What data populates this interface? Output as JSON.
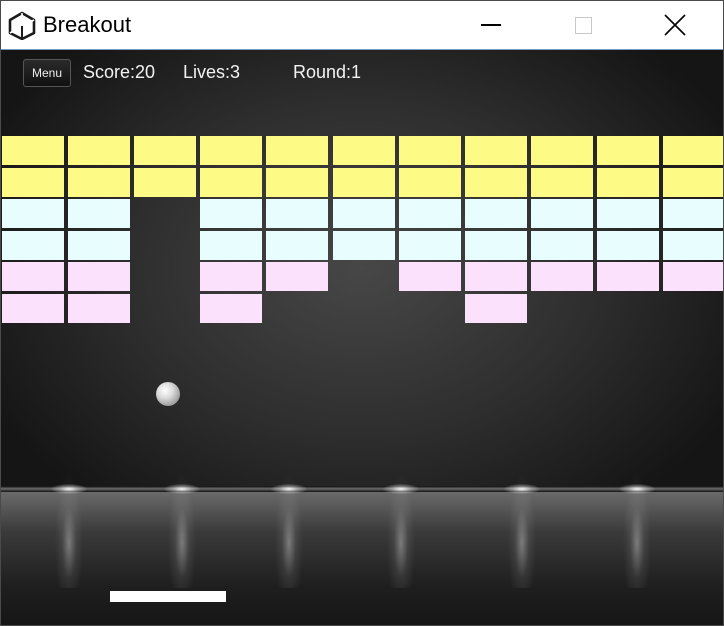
{
  "window": {
    "title": "Breakout",
    "icon": "unity-logo-icon"
  },
  "hud": {
    "menu_label": "Menu",
    "score_text": "Score:20",
    "lives_text": "Lives:3",
    "round_text": "Round:1",
    "score": 20,
    "lives": 3,
    "round": 1
  },
  "colors": {
    "yellow": "#fdfa85",
    "cyan": "#e8fdfd",
    "pink": "#fce1fd",
    "paddle": "#ffffff"
  },
  "bricks": {
    "columns": 11,
    "rows": [
      {
        "color": "yellow",
        "present": [
          1,
          1,
          1,
          1,
          1,
          1,
          1,
          1,
          1,
          1,
          1
        ]
      },
      {
        "color": "yellow",
        "present": [
          1,
          1,
          1,
          1,
          1,
          1,
          1,
          1,
          1,
          1,
          1
        ]
      },
      {
        "color": "cyan",
        "present": [
          1,
          1,
          0,
          1,
          1,
          1,
          1,
          1,
          1,
          1,
          1
        ]
      },
      {
        "color": "cyan",
        "present": [
          1,
          1,
          0,
          1,
          1,
          1,
          1,
          1,
          1,
          1,
          1
        ]
      },
      {
        "color": "pink",
        "present": [
          1,
          1,
          0,
          1,
          1,
          0,
          1,
          1,
          1,
          1,
          1
        ]
      },
      {
        "color": "pink",
        "present": [
          1,
          1,
          0,
          1,
          0,
          0,
          0,
          1,
          0,
          0,
          0
        ]
      }
    ]
  }
}
